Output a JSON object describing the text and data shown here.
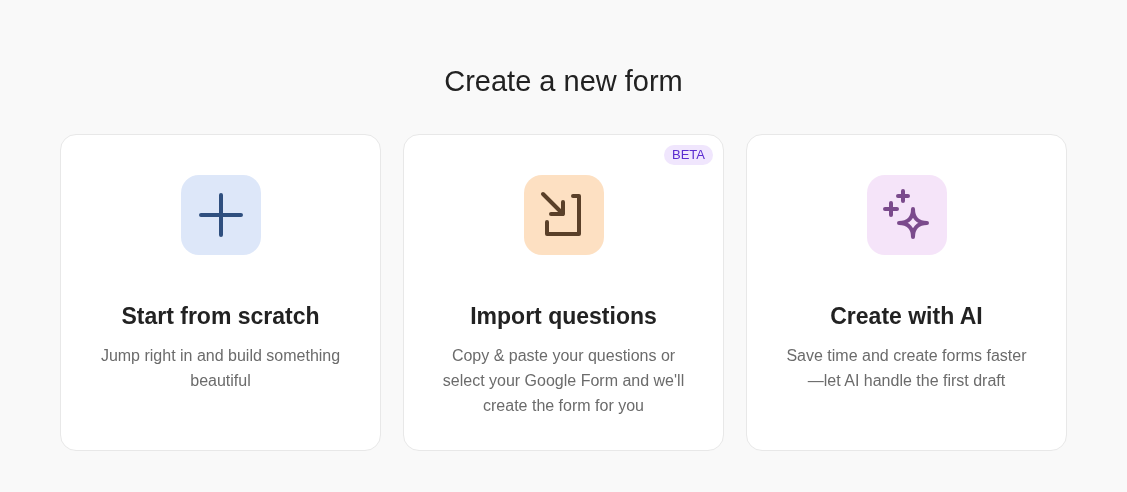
{
  "heading": "Create a new form",
  "cards": [
    {
      "kind": "scratch",
      "title": "Start from scratch",
      "description": "Jump right in and build something beautiful"
    },
    {
      "kind": "import",
      "title": "Import questions",
      "description": "Copy & paste your questions or select your Google Form and we'll create the form for you",
      "badge": "BETA"
    },
    {
      "kind": "ai",
      "title": "Create with AI",
      "description": "Save time and create forms faster —let AI handle the first draft"
    }
  ]
}
